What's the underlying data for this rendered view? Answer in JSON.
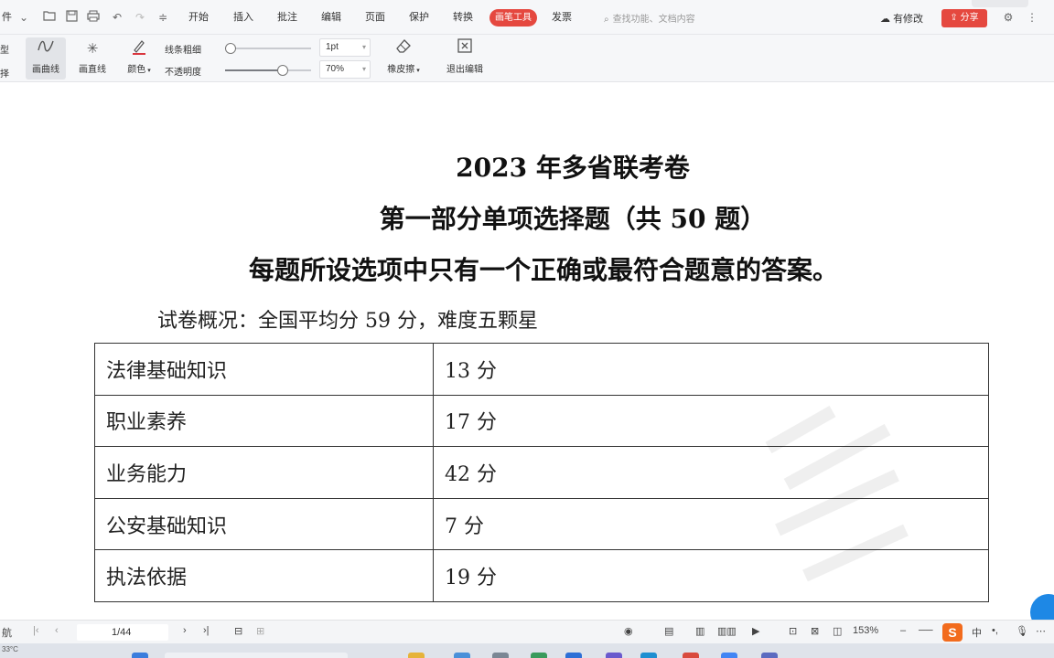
{
  "menubar": {
    "file_label": "件",
    "tabs": [
      "开始",
      "插入",
      "批注",
      "编辑",
      "页面",
      "保护",
      "转换",
      "画笔工具",
      "发票"
    ],
    "active_tab_index": 7,
    "search_placeholder": "查找功能、文档内容",
    "changes_label": "有修改",
    "share_label": "分享",
    "accent_color": "#e5483f"
  },
  "pen_toolbar": {
    "left_edge": [
      "型",
      "择"
    ],
    "tools": [
      {
        "label": "画曲线",
        "icon": "curve-pen-icon"
      },
      {
        "label": "画直线",
        "icon": "straight-line-icon"
      },
      {
        "label": "颜色",
        "icon": "pen-color-icon"
      }
    ],
    "line_width_label": "线条粗细",
    "opacity_label": "不透明度",
    "line_width_value": "1pt",
    "opacity_value": "70%",
    "opacity_level": 0.7,
    "line_width_level": 0.0,
    "eraser_label": "橡皮擦",
    "exit_label": "退出编辑"
  },
  "document": {
    "title_line1": "2023 年多省联考卷",
    "title_line2": "第一部分单项选择题（共 50 题）",
    "title_line3": "每题所设选项中只有一个正确或最符合题意的答案。",
    "overview": "试卷概况：全国平均分 59 分，难度五颗星",
    "score_table": [
      {
        "subject": "法律基础知识",
        "score": "13 分"
      },
      {
        "subject": "职业素养",
        "score": "17 分"
      },
      {
        "subject": "业务能力",
        "score": "42 分"
      },
      {
        "subject": "公安基础知识",
        "score": "7 分"
      },
      {
        "subject": "执法依据",
        "score": "19 分"
      }
    ]
  },
  "statusbar": {
    "nav_label": "航",
    "page_indicator": "1/44",
    "zoom": "153%",
    "ime_label": "S",
    "ime_lang": "中"
  },
  "taskbar": {
    "weather": "33°C"
  }
}
